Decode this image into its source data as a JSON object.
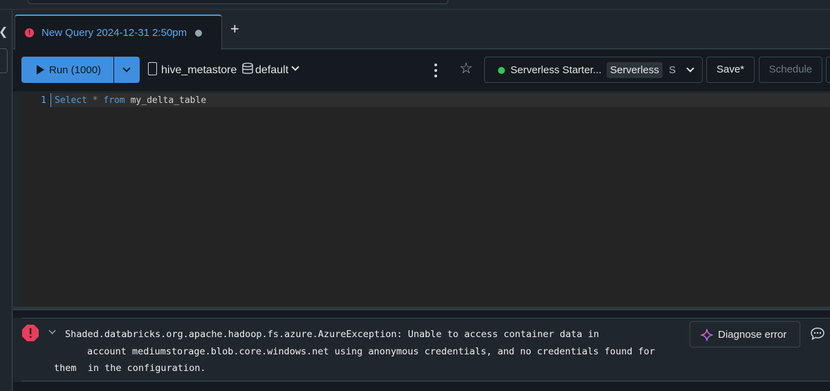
{
  "tab": {
    "title": "New Query 2024-12-31 2:50pm",
    "error_icon": "error-circle-icon",
    "unsaved_icon": "dot-icon",
    "add_icon": "plus-icon"
  },
  "toolbar": {
    "run_label": "Run (1000)",
    "catalog": "hive_metastore",
    "schema": "default",
    "compute_name": "Serverless Starter...",
    "compute_tag": "Serverless",
    "compute_size": "S",
    "compute_status_color": "#34c759",
    "save_label": "Save*",
    "schedule_label": "Schedule"
  },
  "editor": {
    "line_number": "1",
    "kw_select": "Select",
    "op_star": "*",
    "kw_from": "from",
    "table": "my_delta_table"
  },
  "error": {
    "lines": [
      "Shaded.databricks.org.apache.hadoop.fs.azure.AzureException: Unable to access container data in",
      "account mediumstorage.blob.core.windows.net using anonymous credentials, and no credentials found for",
      "them  in the configuration."
    ],
    "diagnose_label": "Diagnose error"
  },
  "colors": {
    "accent": "#3f8fe0",
    "error": "#ea3d5c",
    "tab_title": "#5fa8ef"
  }
}
